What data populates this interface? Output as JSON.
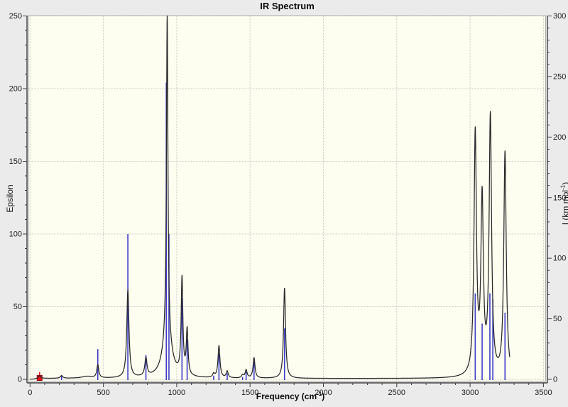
{
  "window": {
    "background": "#ebebeb"
  },
  "title": "IR Spectrum",
  "axes": {
    "x_label_main": "Frequency (cm",
    "x_label_sup": "-1",
    "x_label_end": ")",
    "y_left_label": "Epsilon",
    "y_right_label_main": "I (km mol",
    "y_right_label_sup": "-1",
    "y_right_label_end": ")"
  },
  "chart_data": {
    "type": "line",
    "title": "IR Spectrum",
    "xlabel": "Frequency (cm-1)",
    "ylabel_left": "Epsilon",
    "ylabel_right": "I (km mol-1)",
    "x_range": [
      0,
      3500
    ],
    "y_left_range": [
      0,
      250
    ],
    "y_right_range": [
      0,
      300
    ],
    "x_ticks": [
      0,
      500,
      1000,
      1500,
      2000,
      2500,
      3000,
      3500
    ],
    "x_minor_tick_step": 100,
    "y_left_ticks": [
      0,
      50,
      100,
      150,
      200,
      250
    ],
    "y_right_ticks": [
      0,
      50,
      100,
      150,
      200,
      250,
      300
    ],
    "y_minor_tick_step": 10,
    "grid": "dashed",
    "legend": "none",
    "sticks_axis": "right (km mol-1)",
    "sticks": [
      {
        "freq": 215,
        "intensity": 3.5
      },
      {
        "freq": 462,
        "intensity": 25
      },
      {
        "freq": 667,
        "intensity": 120
      },
      {
        "freq": 790,
        "intensity": 20
      },
      {
        "freq": 929,
        "intensity": 245
      },
      {
        "freq": 947,
        "intensity": 120
      },
      {
        "freq": 1036,
        "intensity": 67
      },
      {
        "freq": 1071,
        "intensity": 33
      },
      {
        "freq": 1252,
        "intensity": 3
      },
      {
        "freq": 1288,
        "intensity": 21
      },
      {
        "freq": 1344,
        "intensity": 5
      },
      {
        "freq": 1449,
        "intensity": 2
      },
      {
        "freq": 1473,
        "intensity": 6
      },
      {
        "freq": 1527,
        "intensity": 15
      },
      {
        "freq": 1735,
        "intensity": 42
      },
      {
        "freq": 3035,
        "intensity": 71
      },
      {
        "freq": 3082,
        "intensity": 46
      },
      {
        "freq": 3135,
        "intensity": 71
      },
      {
        "freq": 3155,
        "intensity": 66
      },
      {
        "freq": 3238,
        "intensity": 55
      }
    ],
    "imaginary_mode": {
      "freq": 65,
      "intensity": 6,
      "marker": "square"
    },
    "envelope_model": "sum of Lorentzians plus baseline, left axis (Epsilon)",
    "baseline_eps": 0.55,
    "envelope_peaks": [
      {
        "freq": 65,
        "eps_max": 1.8,
        "hwhm": 10
      },
      {
        "freq": 215,
        "eps_max": 1.8,
        "hwhm": 10
      },
      {
        "freq": 390,
        "eps_max": 1.3,
        "hwhm": 45
      },
      {
        "freq": 462,
        "eps_max": 9,
        "hwhm": 8
      },
      {
        "freq": 667,
        "eps_max": 60,
        "hwhm": 9
      },
      {
        "freq": 790,
        "eps_max": 12.5,
        "hwhm": 9
      },
      {
        "freq": 935,
        "eps_max": 222,
        "hwhm": 6
      },
      {
        "freq": 935,
        "eps_max": 28,
        "hwhm": 35
      },
      {
        "freq": 1036,
        "eps_max": 66,
        "hwhm": 7
      },
      {
        "freq": 1071,
        "eps_max": 31,
        "hwhm": 7
      },
      {
        "freq": 1252,
        "eps_max": 2.5,
        "hwhm": 8
      },
      {
        "freq": 1288,
        "eps_max": 22,
        "hwhm": 8
      },
      {
        "freq": 1344,
        "eps_max": 4.5,
        "hwhm": 8
      },
      {
        "freq": 1449,
        "eps_max": 2,
        "hwhm": 8
      },
      {
        "freq": 1473,
        "eps_max": 5.5,
        "hwhm": 8
      },
      {
        "freq": 1527,
        "eps_max": 14,
        "hwhm": 8
      },
      {
        "freq": 1735,
        "eps_max": 62,
        "hwhm": 8
      },
      {
        "freq": 3035,
        "eps_max": 166,
        "hwhm": 10
      },
      {
        "freq": 3082,
        "eps_max": 119,
        "hwhm": 10
      },
      {
        "freq": 3138,
        "eps_max": 177,
        "hwhm": 10
      },
      {
        "freq": 3238,
        "eps_max": 154,
        "hwhm": 10
      }
    ],
    "envelope_domain": [
      0,
      3270
    ],
    "colors": {
      "curve": "#282828",
      "stick": "#3d3dcb",
      "imaginary": "#e01313",
      "plot_bg": "#fdfdf0",
      "grid": "#c9c9c4",
      "axis": "#3f3f3f",
      "text": "#1c1c1c"
    }
  }
}
